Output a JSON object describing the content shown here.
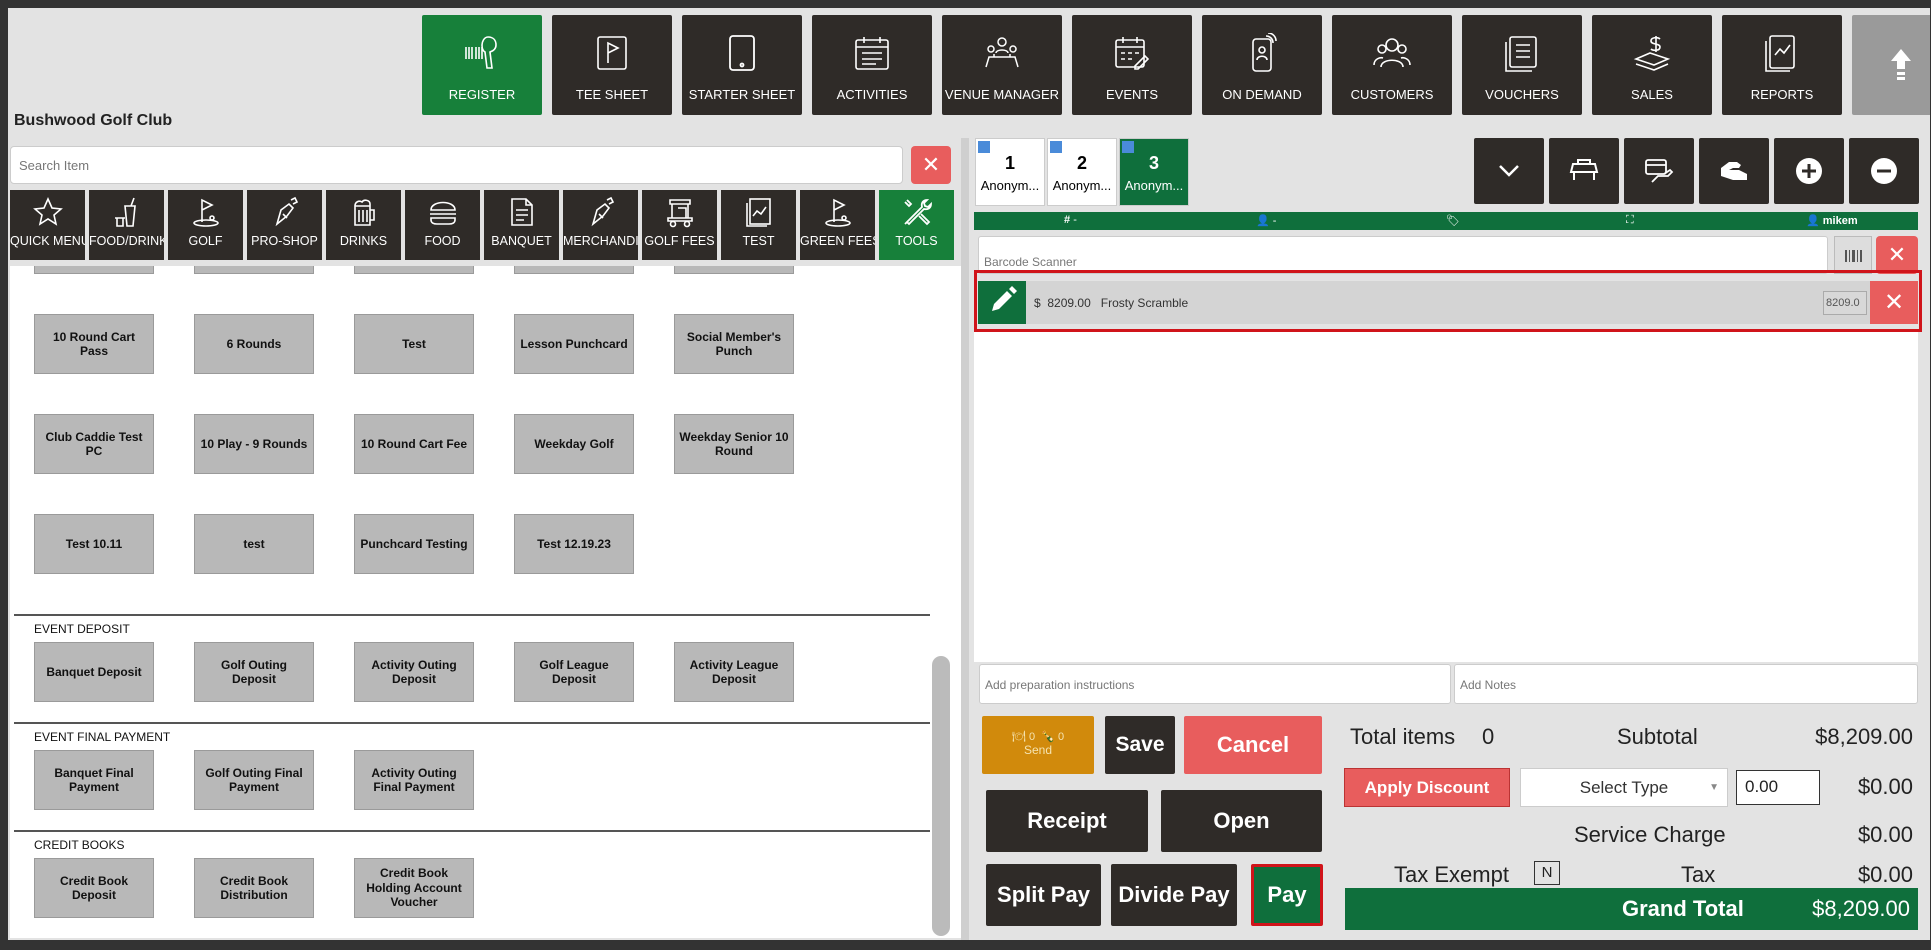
{
  "club_name": "Bushwood Golf Club",
  "nav": {
    "items": [
      {
        "label": "REGISTER",
        "icon": "barcode-scanner-icon"
      },
      {
        "label": "TEE SHEET",
        "icon": "flag-icon"
      },
      {
        "label": "STARTER SHEET",
        "icon": "tablet-icon"
      },
      {
        "label": "ACTIVITIES",
        "icon": "calendar-icon"
      },
      {
        "label": "VENUE MANAGER",
        "icon": "meeting-icon"
      },
      {
        "label": "EVENTS",
        "icon": "calendar-edit-icon"
      },
      {
        "label": "ON DEMAND",
        "icon": "phone-icon"
      },
      {
        "label": "CUSTOMERS",
        "icon": "users-icon"
      },
      {
        "label": "VOUCHERS",
        "icon": "voucher-icon"
      },
      {
        "label": "SALES",
        "icon": "money-icon"
      },
      {
        "label": "REPORTS",
        "icon": "report-icon"
      }
    ],
    "collapse_icon": "arrow-up-icon"
  },
  "search": {
    "placeholder": "Search Item"
  },
  "categories": [
    {
      "label": "QUICK MENU",
      "icon": "star-icon"
    },
    {
      "label": "FOOD/DRINK",
      "icon": "drink-icon"
    },
    {
      "label": "GOLF",
      "icon": "golf-icon"
    },
    {
      "label": "PRO-SHOP",
      "icon": "golf-bag-icon"
    },
    {
      "label": "DRINKS",
      "icon": "beer-icon"
    },
    {
      "label": "FOOD",
      "icon": "burger-icon"
    },
    {
      "label": "BANQUET",
      "icon": "document-icon"
    },
    {
      "label": "MERCHANDI",
      "icon": "golf-bag-icon"
    },
    {
      "label": "GOLF FEES",
      "icon": "cart-icon"
    },
    {
      "label": "TEST",
      "icon": "chart-icon"
    },
    {
      "label": "GREEN FEES",
      "icon": "golf-icon"
    },
    {
      "label": "TOOLS",
      "icon": "tools-icon"
    }
  ],
  "items_rows": [
    [
      "10 Round Cart Pass",
      "6 Rounds",
      "Test",
      "Lesson Punchcard",
      "Social Member's Punch"
    ],
    [
      "Club Caddie Test PC",
      "10 Play - 9 Rounds",
      "10 Round Cart Fee",
      "Weekday Golf",
      "Weekday Senior 10 Round"
    ],
    [
      "Test 10.11",
      "test",
      "Punchcard Testing",
      "Test 12.19.23"
    ]
  ],
  "sections": [
    {
      "title": "EVENT DEPOSIT",
      "items": [
        "Banquet Deposit",
        "Golf Outing Deposit",
        "Activity Outing Deposit",
        "Golf League Deposit",
        "Activity League Deposit"
      ]
    },
    {
      "title": "EVENT FINAL PAYMENT",
      "items": [
        "Banquet Final Payment",
        "Golf Outing Final Payment",
        "Activity Outing Final Payment"
      ]
    },
    {
      "title": "CREDIT BOOKS",
      "items": [
        "Credit Book Deposit",
        "Credit Book Distribution",
        "Credit Book Holding Account Voucher"
      ]
    }
  ],
  "tickets": [
    {
      "num": "1",
      "name": "Anonym..."
    },
    {
      "num": "2",
      "name": "Anonym..."
    },
    {
      "num": "3",
      "name": "Anonym..."
    }
  ],
  "info_bar": {
    "table_icon": "#",
    "table": "-",
    "customer": "-",
    "user": "mikem"
  },
  "barcode": {
    "placeholder": "Barcode Scanner"
  },
  "line_item": {
    "currency": "$",
    "price": "8209.00",
    "name": "Frosty Scramble",
    "amount": "8209.0"
  },
  "notes": {
    "prep_placeholder": "Add preparation instructions",
    "notes_placeholder": "Add Notes"
  },
  "send": {
    "count1": "0",
    "count2": "0",
    "label": "Send"
  },
  "buttons": {
    "save": "Save",
    "cancel": "Cancel",
    "receipt": "Receipt",
    "open": "Open",
    "split_pay": "Split Pay",
    "divide_pay": "Divide Pay",
    "pay": "Pay",
    "apply_discount": "Apply Discount"
  },
  "totals": {
    "total_items_label": "Total items",
    "total_items": "0",
    "subtotal_label": "Subtotal",
    "subtotal": "$8,209.00",
    "discount_type": "Select Type",
    "discount_value": "0.00",
    "discount_amount": "$0.00",
    "service_charge_label": "Service Charge",
    "service_charge": "$0.00",
    "tax_exempt_label": "Tax Exempt",
    "tax_exempt_value": "N",
    "tax_label": "Tax",
    "tax": "$0.00",
    "grand_total_label": "Grand Total",
    "grand_total": "$8,209.00"
  },
  "colors": {
    "accent_green": "#17803a",
    "dark": "#2f2b28",
    "danger": "#e85d5d",
    "send_orange": "#d18a0c",
    "highlight_red": "#d0141a"
  }
}
